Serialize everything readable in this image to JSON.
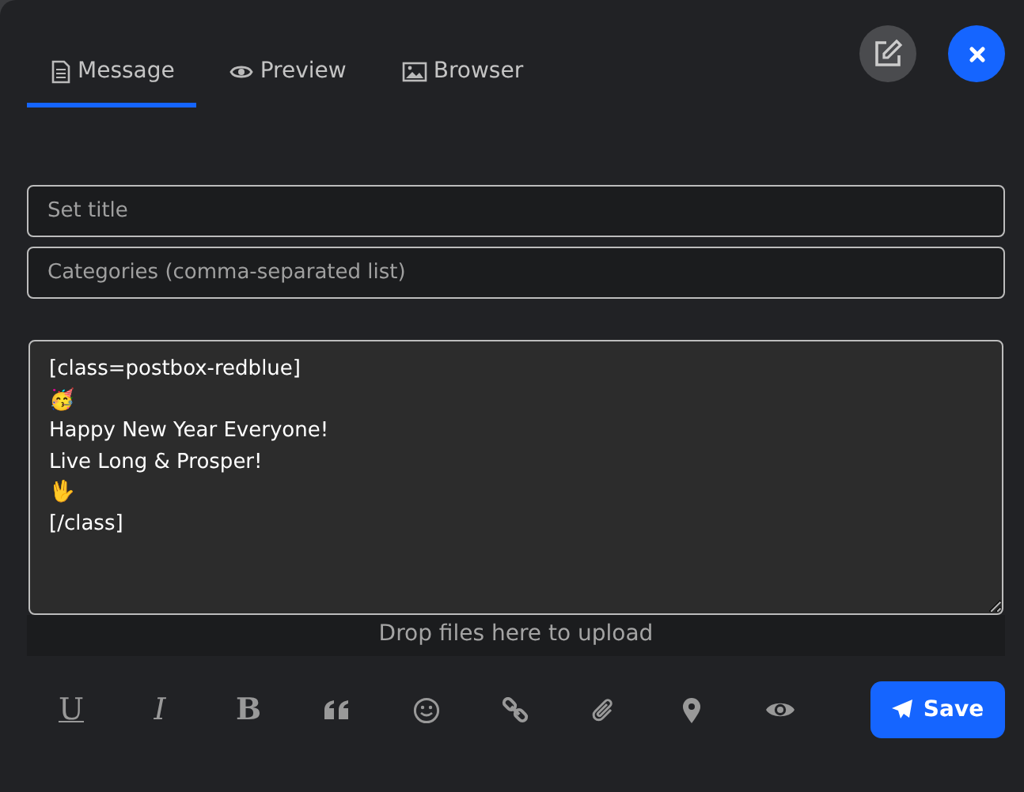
{
  "tabs": [
    {
      "label": "Message",
      "kind": "document",
      "selected": true
    },
    {
      "label": "Preview",
      "kind": "eye",
      "selected": false
    },
    {
      "label": "Browser",
      "kind": "image",
      "selected": false
    }
  ],
  "title_field": {
    "placeholder": "Set title"
  },
  "categories_field": {
    "placeholder": "Categories (comma-separated list)"
  },
  "body": {
    "value": "[class=postbox-redblue]\n🥳\nHappy New Year Everyone!\nLive Long & Prosper!\n🖖\n[/class]"
  },
  "dropzone": {
    "label": "Drop files here to upload"
  },
  "toolbar": [
    {
      "kind": "underline",
      "text": "U"
    },
    {
      "kind": "italic",
      "text": "I"
    },
    {
      "kind": "bold",
      "text": "B"
    },
    {
      "kind": "quote"
    },
    {
      "kind": "smiley"
    },
    {
      "kind": "link"
    },
    {
      "kind": "paperclip"
    },
    {
      "kind": "pin"
    },
    {
      "kind": "eye"
    }
  ],
  "save_button": {
    "label": "Save"
  }
}
